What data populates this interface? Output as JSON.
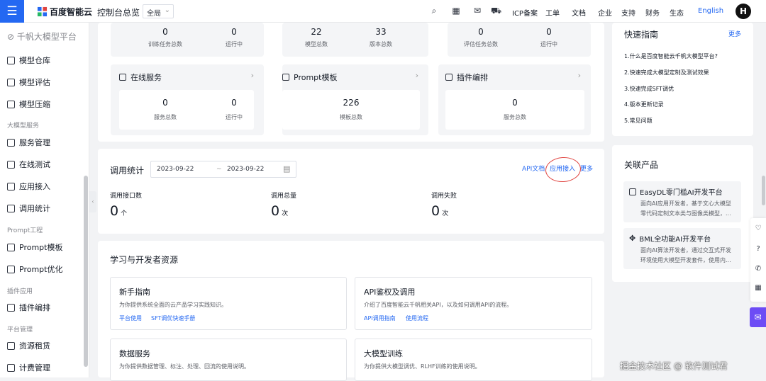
{
  "topbar": {
    "brand": "百度智能云",
    "console": "控制台总览",
    "scope": "全局",
    "links": [
      "ICP备案",
      "工单",
      "文档",
      "企业",
      "支持",
      "财务",
      "生态"
    ],
    "language": "English",
    "avatar": "H"
  },
  "sidebar": {
    "platform": "千帆大模型平台",
    "top_items": [
      "模型仓库",
      "模型评估",
      "模型压缩"
    ],
    "groups": [
      {
        "label": "大模型服务",
        "items": [
          "服务管理",
          "在线测试",
          "应用接入",
          "调用统计"
        ]
      },
      {
        "label": "Prompt工程",
        "items": [
          "Prompt模板",
          "Prompt优化"
        ]
      },
      {
        "label": "插件应用",
        "items": [
          "插件编排"
        ]
      },
      {
        "label": "平台管理",
        "items": [
          "资源租赁",
          "计费管理"
        ]
      }
    ]
  },
  "overview_top": {
    "t1": {
      "a_num": "0",
      "a_lbl": "训练任务总数",
      "b_num": "0",
      "b_lbl": "运行中"
    },
    "t2": {
      "a_num": "22",
      "a_lbl": "模型总数",
      "b_num": "33",
      "b_lbl": "版本总数"
    },
    "t3": {
      "a_num": "0",
      "a_lbl": "评估任务总数",
      "b_num": "0",
      "b_lbl": "运行中"
    }
  },
  "overview_tiles": {
    "online": {
      "title": "在线服务",
      "a_num": "0",
      "a_lbl": "服务总数",
      "b_num": "0",
      "b_lbl": "运行中"
    },
    "prompt": {
      "title": "Prompt模板",
      "num": "226",
      "lbl": "模板总数"
    },
    "plugin": {
      "title": "插件编排",
      "num": "0",
      "lbl": "服务总数"
    }
  },
  "call_stats": {
    "title": "调用统计",
    "date_start": "2023-09-22",
    "date_sep": "~",
    "date_end": "2023-09-22",
    "links": {
      "api_doc": "API文档",
      "app_access": "应用接入",
      "more": "更多"
    },
    "metrics": [
      {
        "label": "调用接口数",
        "value": "0",
        "unit": "个"
      },
      {
        "label": "调用总量",
        "value": "0",
        "unit": "次"
      },
      {
        "label": "调用失败",
        "value": "0",
        "unit": "次"
      }
    ]
  },
  "resources": {
    "title": "学习与开发者资源",
    "cards": [
      {
        "title": "新手指南",
        "desc": "为你提供系统全面的云产品学习实践知识。",
        "links": [
          "平台使用",
          "SFT调优快速手册"
        ]
      },
      {
        "title": "API鉴权及调用",
        "desc": "介绍了百度智能云千帆相关API，以及如何调用API的流程。",
        "links": [
          "API调用指南",
          "使用流程"
        ]
      },
      {
        "title": "数据服务",
        "desc": "为你提供数据管理、标注、处理、回流的使用说明。"
      },
      {
        "title": "大模型训练",
        "desc": "为你提供大模型调优、RLHF训练的使用说明。"
      }
    ]
  },
  "quick_guide": {
    "title": "快速指南",
    "more": "更多",
    "items": [
      "1.什么是百度智能云千帆大模型平台?",
      "2.快速完成大模型定制及测试效果",
      "3.快速完成SFT调优",
      "4.版本更新记录",
      "5.常见问题"
    ]
  },
  "related": {
    "title": "关联产品",
    "products": [
      {
        "title": "EasyDL零门槛AI开发平台",
        "desc1": "面向AI应用开发者，基于文心大模型",
        "desc2": "零代码定制文本类与图像类模型，..."
      },
      {
        "title": "BML全功能AI开发平台",
        "desc1": "面向AI算法开发者，通过交互式开发",
        "desc2": "环境使用大模型开发套件，使用内..."
      }
    ]
  },
  "watermark": "掘金技术社区 @ 软件测试君",
  "colors": {
    "brand_blue": "#2468f2",
    "annotation_red": "#e0433f",
    "chat_purple": "#6d4cf5"
  }
}
